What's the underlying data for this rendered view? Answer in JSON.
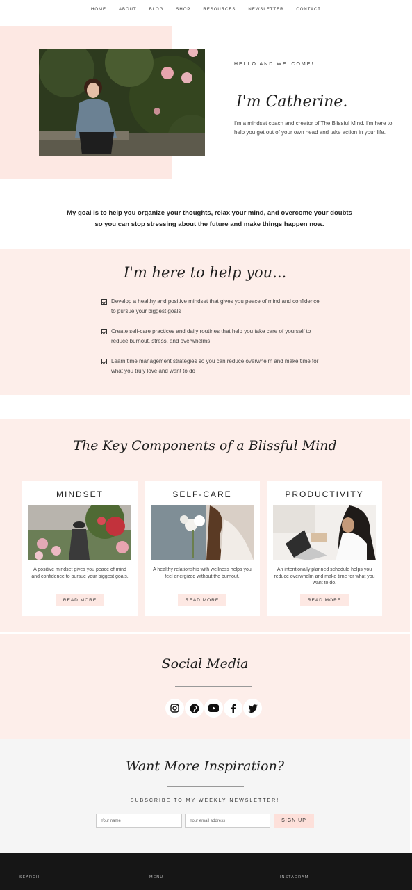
{
  "nav": {
    "items": [
      "HOME",
      "ABOUT",
      "BLOG",
      "SHOP",
      "RESOURCES",
      "NEWSLETTER",
      "CONTACT"
    ]
  },
  "hero": {
    "eyebrow": "HELLO AND WELCOME!",
    "title": "I'm Catherine.",
    "text": "I'm a mindset coach and creator of The Blissful Mind. I'm here to help you get out of your own head and take action in your life."
  },
  "goal": "My goal is to help you organize your thoughts, relax your mind, and overcome your doubts so you can stop stressing about the future and make things happen now.",
  "help": {
    "title": "I'm here to help you...",
    "items": [
      "Develop a healthy and positive mindset that gives you peace of mind and confidence to pursue your biggest goals",
      "Create self-care practices and daily routines that help you take care of yourself to reduce burnout, stress, and overwhelms",
      "Learn time management strategies so you can reduce overwhelm and make time for what you truly love and want to do"
    ]
  },
  "key": {
    "title": "The Key Components of a Blissful Mind",
    "cards": [
      {
        "title": "MINDSET",
        "text": "A positive mindset gives you peace of mind and confidence to pursue your biggest goals.",
        "button": "READ MORE"
      },
      {
        "title": "SELF-CARE",
        "text": "A healthy relationship with wellness helps you feel energized without the burnout.",
        "button": "READ MORE"
      },
      {
        "title": "PRODUCTIVITY",
        "text": "An intentionally planned schedule helps you reduce overwhelm and make time for what you want to do.",
        "button": "READ MORE"
      }
    ]
  },
  "social": {
    "title": "Social Media",
    "icons": [
      "instagram-icon",
      "pinterest-icon",
      "youtube-icon",
      "facebook-icon",
      "twitter-icon"
    ]
  },
  "newsletter": {
    "title": "Want More Inspiration?",
    "subtitle": "SUBSCRIBE TO MY WEEKLY NEWSLETTER!",
    "name_placeholder": "Your name",
    "email_placeholder": "Your email address",
    "button": "SIGN UP"
  },
  "footer": {
    "col1": "SEARCH",
    "col2": "MENU",
    "col3": "INSTAGRAM"
  },
  "colors": {
    "pink": "#fde8e3",
    "dark": "#161616"
  }
}
